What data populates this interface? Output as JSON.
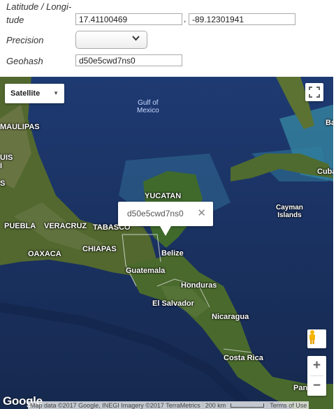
{
  "form": {
    "latlon_label_line1": "Latitude / Longi-",
    "latlon_label_line2": "tude",
    "latitude": "17.41100469",
    "separator": ",",
    "longitude": "-89.12301941",
    "precision_label": "Precision",
    "precision_value": "",
    "geohash_label": "Geohash",
    "geohash": "d50e5cwd7ns0"
  },
  "map": {
    "map_type": "Satellite",
    "infowindow_text": "d50e5cwd7ns0",
    "labels": {
      "gulf": "Gulf of\nMexico",
      "maulipas": "MAULIPAS",
      "luis_1": "UIS",
      "luis_2": "I",
      "luis_3": "S",
      "yucatan": "YUCATAN",
      "puebla": "PUEBLA",
      "veracruz": "VERACRUZ",
      "tabasco": "TABASCO",
      "oaxaca": "OAXACA",
      "chiapas": "CHIAPAS",
      "belize": "Belize",
      "guatemala": "Guatemala",
      "honduras": "Honduras",
      "el_salvador": "El Salvador",
      "nicaragua": "Nicaragua",
      "costa_rica": "Costa Rica",
      "cayman": "Cayman\nIslands",
      "cuba": "Cuba",
      "bahamas": "Ba",
      "panama": "Pan"
    },
    "google_logo": "Google",
    "attribution": "Map data ©2017 Google, INEGI Imagery ©2017 TerraMetrics",
    "scale": "200 km",
    "terms": "Terms of Use"
  },
  "colors": {
    "ocean_deep": "#1b3466",
    "ocean_shallow": "#3fa7b8",
    "land": "#4f6b2f"
  }
}
